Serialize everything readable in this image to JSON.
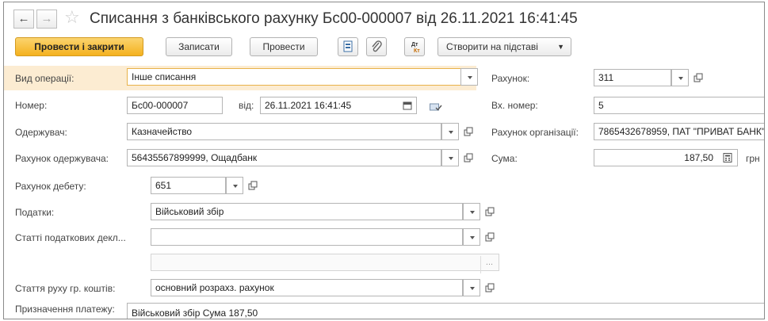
{
  "window": {
    "title": "Списання з банківського рахунку Бс00-000007 від 26.11.2021 16:41:45"
  },
  "toolbar": {
    "post_close_label": "Провести і закрити",
    "save_label": "Записати",
    "post_label": "Провести",
    "create_based_label": "Створити на підставі"
  },
  "form": {
    "operation_type": {
      "label": "Вид операції:",
      "value": "Інше списання"
    },
    "number": {
      "label": "Номер:",
      "value": "Бс00-000007"
    },
    "date": {
      "label": "від:",
      "value": "26.11.2021 16:41:45"
    },
    "recipient": {
      "label": "Одержувач:",
      "value": "Казначейство"
    },
    "recipient_account": {
      "label": "Рахунок одержувача:",
      "value": "56435567899999, Ощадбанк"
    },
    "debit_account": {
      "label": "Рахунок дебету:",
      "value": "651"
    },
    "taxes": {
      "label": "Податки:",
      "value": "Військовий збір"
    },
    "tax_decl_articles": {
      "label": "Статті податкових декл...",
      "value": ""
    },
    "cash_flow_article": {
      "label": "Стаття руху гр. коштів:",
      "value": "основний розрахз. рахунок"
    },
    "purpose": {
      "label": "Призначення платежу:",
      "value": "Військовий збір Сума 187,50"
    },
    "account": {
      "label": "Рахунок:",
      "value": "311"
    },
    "incoming_number": {
      "label": "Вх. номер:",
      "value": "5"
    },
    "org_account": {
      "label": "Рахунок організації:",
      "value": "7865432678959, ПАТ \"ПРИВАТ БАНК\""
    },
    "amount": {
      "label": "Сума:",
      "value": "187,50",
      "currency": "грн"
    },
    "ellipsis": "..."
  },
  "icons": {
    "back": "arrow-left-icon",
    "forward": "arrow-right-icon",
    "favorite": "star-icon",
    "structure": "document-structure-icon",
    "attach": "paperclip-icon",
    "dt_kt": "dt-kt-icon",
    "calendar": "calendar-icon",
    "calculator": "calculator-icon"
  },
  "colors": {
    "primary_button": "#f4b11e",
    "highlight_row": "#fcecd2"
  }
}
